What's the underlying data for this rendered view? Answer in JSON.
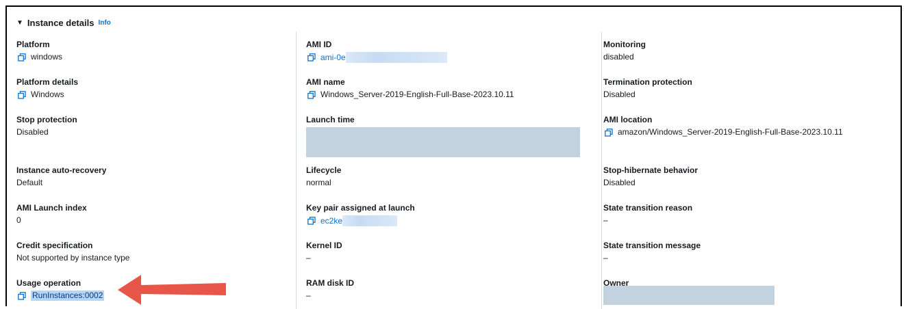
{
  "section": {
    "title": "Instance details",
    "info": "Info"
  },
  "columns": [
    [
      {
        "label": "Platform",
        "value": "windows",
        "copy": true,
        "link": false
      },
      {
        "label": "Platform details",
        "value": "Windows",
        "copy": true,
        "link": false
      },
      {
        "label": "Stop protection",
        "value": "Disabled",
        "copy": false,
        "link": false
      },
      {
        "label": "Instance auto-recovery",
        "value": "Default",
        "copy": false,
        "link": false
      },
      {
        "label": "AMI Launch index",
        "value": "0",
        "copy": false,
        "link": false
      },
      {
        "label": "Credit specification",
        "value": "Not supported by instance type",
        "copy": false,
        "link": false
      },
      {
        "label": "Usage operation",
        "value": "RunInstances:0002",
        "copy": true,
        "link": false,
        "highlighted": true
      }
    ],
    [
      {
        "label": "AMI ID",
        "value": "ami-0e",
        "copy": true,
        "link": true,
        "redacted": true
      },
      {
        "label": "AMI name",
        "value": "Windows_Server-2019-English-Full-Base-2023.10.11",
        "copy": true,
        "link": false
      },
      {
        "label": "Launch time",
        "value": "",
        "copy": false,
        "link": false,
        "redacted": true
      },
      {
        "label": "Lifecycle",
        "value": "normal",
        "copy": false,
        "link": false
      },
      {
        "label": "Key pair assigned at launch",
        "value": "ec2ke",
        "copy": true,
        "link": true,
        "redacted": true
      },
      {
        "label": "Kernel ID",
        "value": "–",
        "copy": false,
        "link": false
      },
      {
        "label": "RAM disk ID",
        "value": "–",
        "copy": false,
        "link": false
      }
    ],
    [
      {
        "label": "Monitoring",
        "value": "disabled",
        "copy": false,
        "link": false
      },
      {
        "label": "Termination protection",
        "value": "Disabled",
        "copy": false,
        "link": false
      },
      {
        "label": "AMI location",
        "value": "amazon/Windows_Server-2019-English-Full-Base-2023.10.11",
        "copy": true,
        "link": false
      },
      {
        "label": "Stop-hibernate behavior",
        "value": "Disabled",
        "copy": false,
        "link": false
      },
      {
        "label": "State transition reason",
        "value": "–",
        "copy": false,
        "link": false
      },
      {
        "label": "State transition message",
        "value": "–",
        "copy": false,
        "link": false
      },
      {
        "label": "Owner",
        "value": "",
        "copy": false,
        "link": false,
        "redacted": true
      }
    ]
  ],
  "colors": {
    "link": "#0972d3",
    "arrow": "#e8564a",
    "highlight": "#b5d5fb",
    "redaction": "#c3d2df"
  },
  "icons": {
    "copy": "copy-icon",
    "caret": "caret-down-icon",
    "annotation": "red-arrow-icon"
  }
}
